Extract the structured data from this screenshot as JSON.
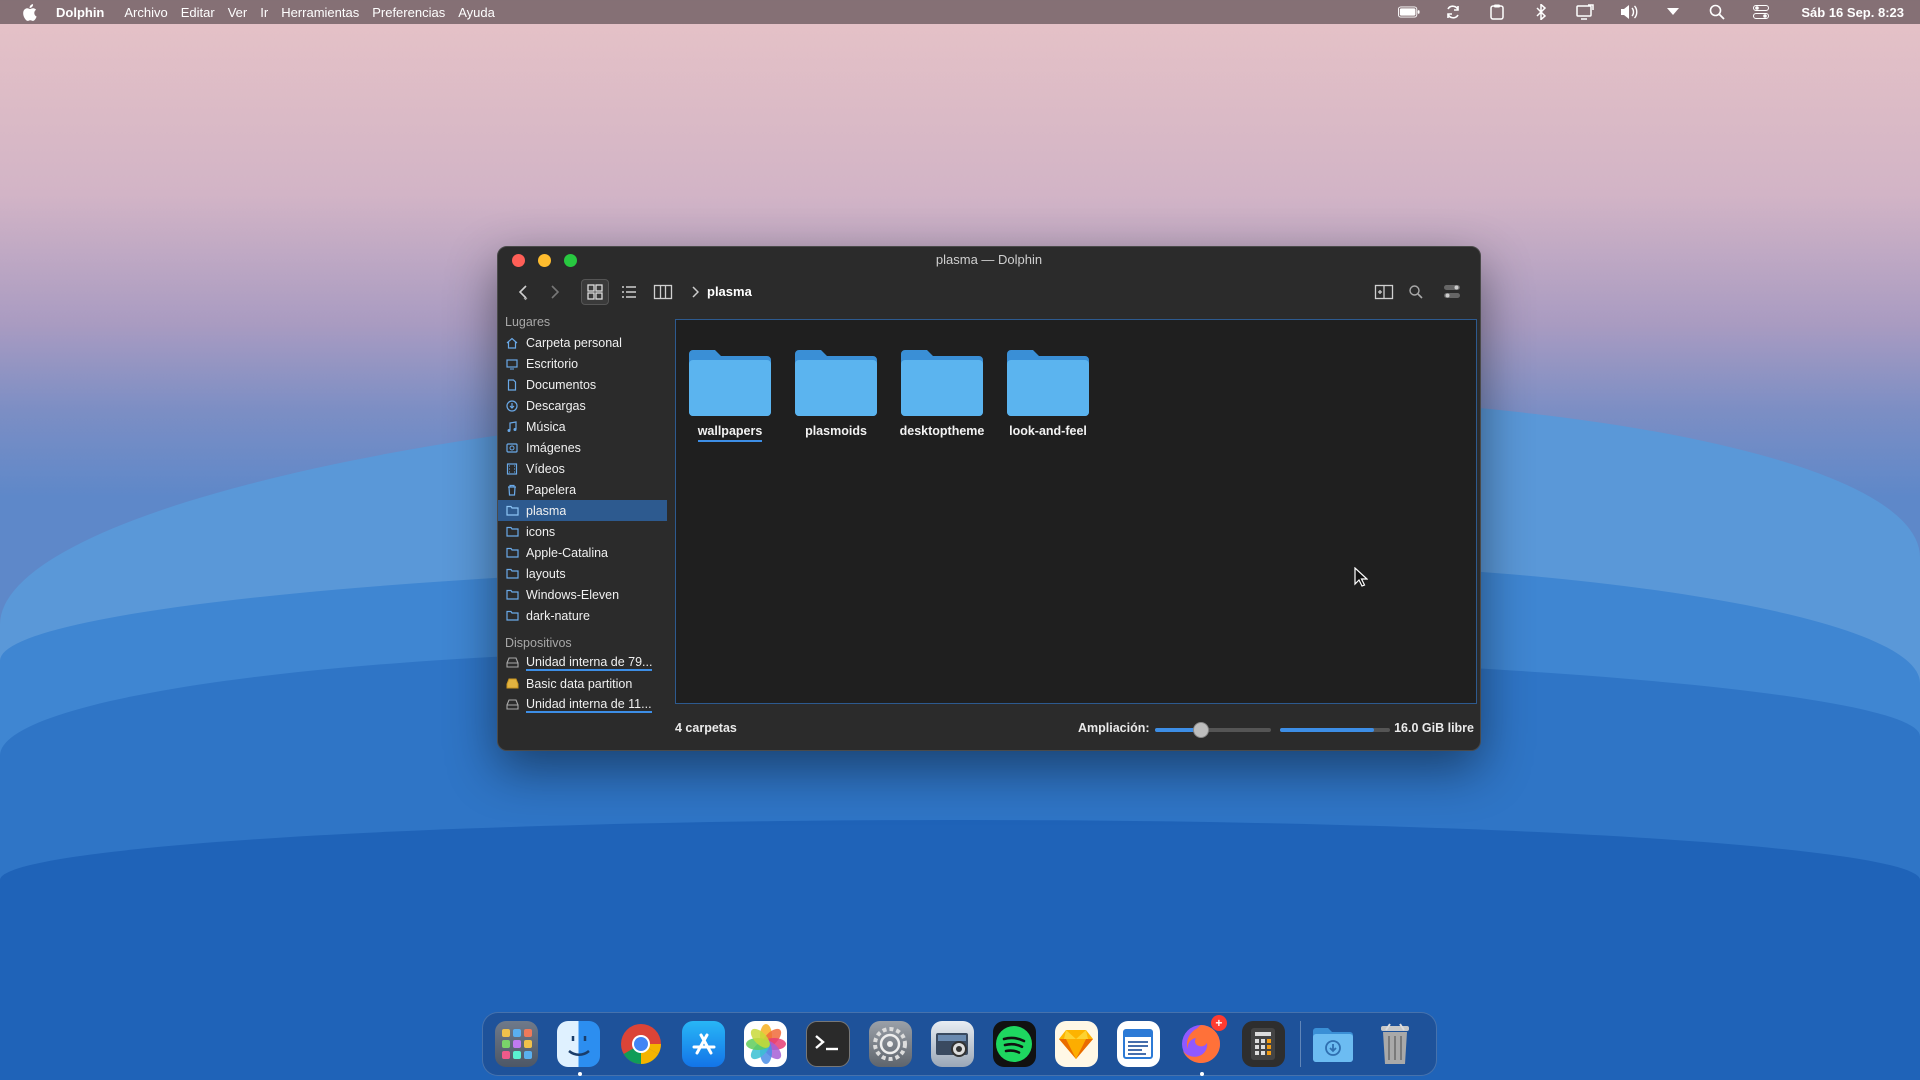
{
  "menubar": {
    "app_name": "Dolphin",
    "menus": [
      "Archivo",
      "Editar",
      "Ver",
      "Ir",
      "Herramientas",
      "Preferencias",
      "Ayuda"
    ],
    "clock": "Sáb 16 Sep. 8:23"
  },
  "window": {
    "title": "plasma — Dolphin",
    "breadcrumb": "plasma"
  },
  "sidebar": {
    "places_title": "Lugares",
    "places": [
      {
        "label": "Carpeta personal",
        "icon": "home-icon"
      },
      {
        "label": "Escritorio",
        "icon": "desktop-icon"
      },
      {
        "label": "Documentos",
        "icon": "documents-icon"
      },
      {
        "label": "Descargas",
        "icon": "downloads-icon"
      },
      {
        "label": "Música",
        "icon": "music-icon"
      },
      {
        "label": "Imágenes",
        "icon": "pictures-icon"
      },
      {
        "label": "Vídeos",
        "icon": "videos-icon"
      },
      {
        "label": "Papelera",
        "icon": "trash-icon"
      },
      {
        "label": "plasma",
        "icon": "folder-icon"
      },
      {
        "label": "icons",
        "icon": "folder-icon"
      },
      {
        "label": "Apple-Catalina",
        "icon": "folder-icon"
      },
      {
        "label": "layouts",
        "icon": "folder-icon"
      },
      {
        "label": "Windows-Eleven",
        "icon": "folder-icon"
      },
      {
        "label": "dark-nature",
        "icon": "folder-icon"
      }
    ],
    "devices_title": "Dispositivos",
    "devices": [
      {
        "label": "Unidad interna de 79...",
        "icon": "drive-icon"
      },
      {
        "label": "Basic data partition",
        "icon": "drive-locked-icon"
      },
      {
        "label": "Unidad interna de 11...",
        "icon": "drive-icon"
      }
    ]
  },
  "folders": [
    "wallpapers",
    "plasmoids",
    "desktoptheme",
    "look-and-feel"
  ],
  "status": {
    "count": "4 carpetas",
    "zoom_label": "Ampliación:",
    "zoom_level": 0.4,
    "free_space": "16.0 GiB libre",
    "space_used_fraction": 0.85
  },
  "dock": {
    "apps": [
      "launchpad-icon",
      "finder-icon",
      "chrome-icon",
      "app-store-icon",
      "photos-icon",
      "terminal-icon",
      "settings-icon",
      "screenshot-icon",
      "spotify-icon",
      "sketch-icon",
      "text-editor-icon",
      "firefox-icon",
      "calculator-icon",
      "downloads-folder-icon",
      "trash-icon"
    ],
    "firefox_badge": "+"
  },
  "colors": {
    "accent": "#3d8ee6",
    "selection": "#2d5a8f",
    "folder": "#4aa8e8"
  }
}
